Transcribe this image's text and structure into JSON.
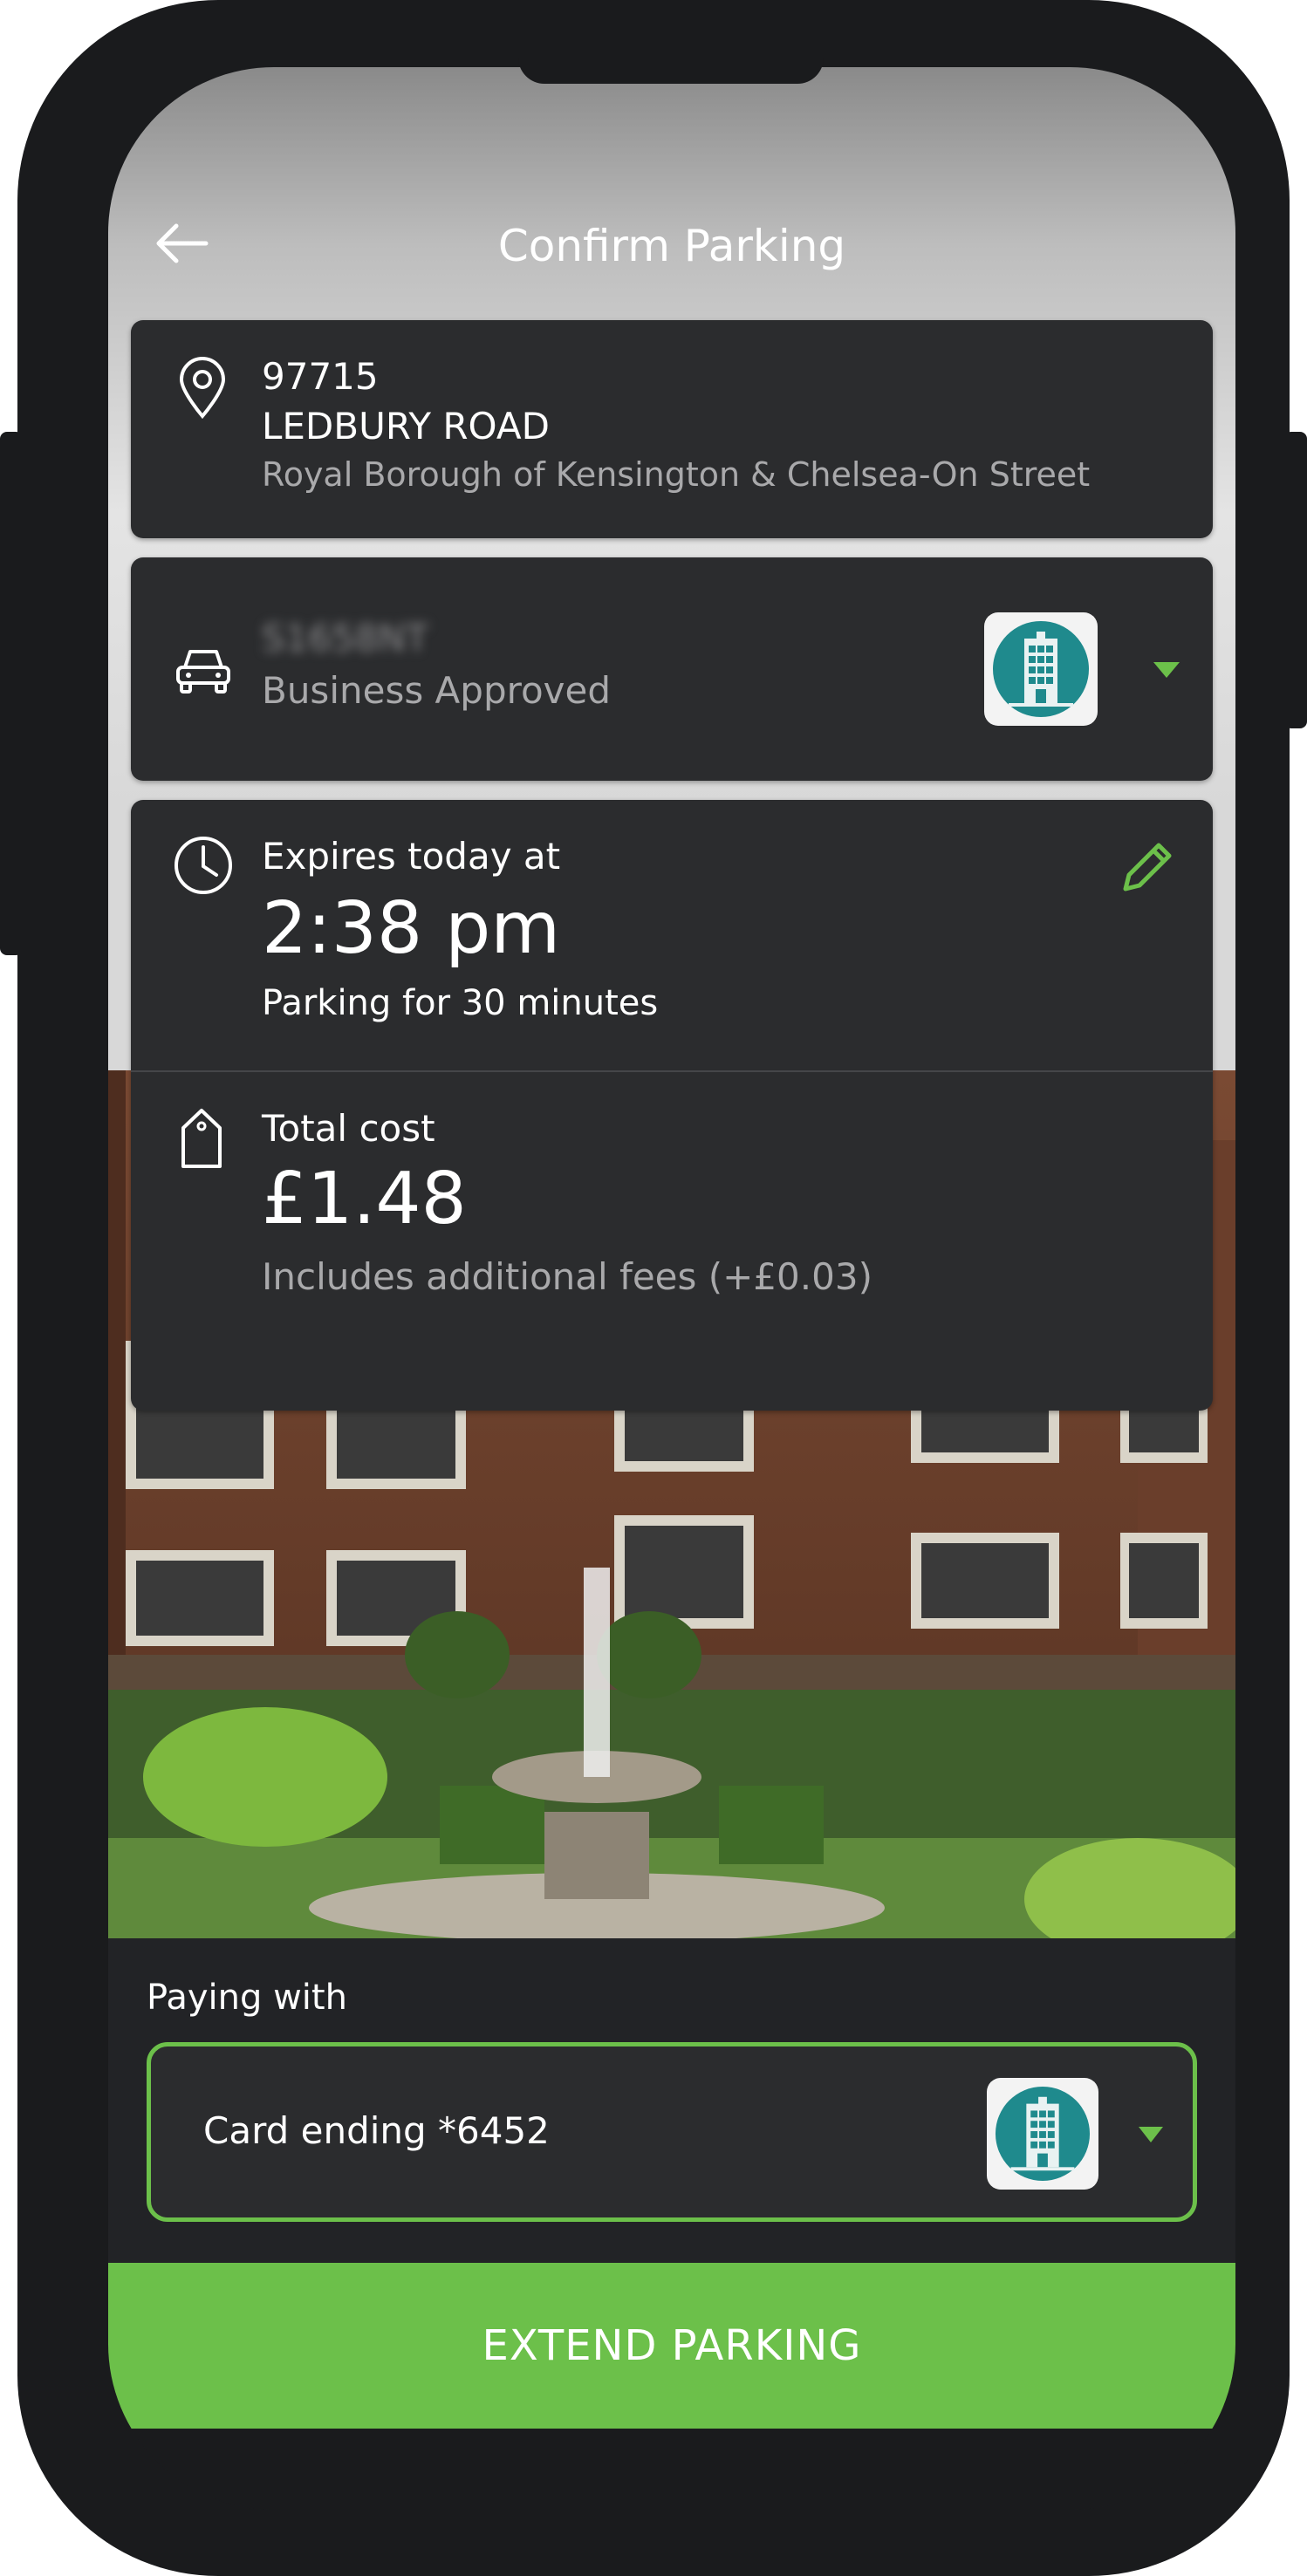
{
  "header": {
    "title": "Confirm Parking"
  },
  "location": {
    "zone": "97715",
    "street": "LEDBURY ROAD",
    "area": "Royal Borough of Kensington & Chelsea-On Street"
  },
  "vehicle": {
    "plate": "S1658NT",
    "status": "Business Approved"
  },
  "expiry": {
    "label": "Expires today at",
    "time": "2:38 pm",
    "duration": "Parking for 30 minutes"
  },
  "cost": {
    "label": "Total cost",
    "amount": "£1.48",
    "fees_note": "Includes additional fees (+£0.03)"
  },
  "payment": {
    "label": "Paying with",
    "card": "Card ending *6452"
  },
  "action": {
    "extend_label": "EXTEND PARKING"
  },
  "colors": {
    "accent": "#6cc04a",
    "card_bg": "#2b2c2e",
    "teal": "#1f8a8d"
  },
  "icons": [
    "back-arrow-icon",
    "location-pin-icon",
    "car-icon",
    "building-icon",
    "dropdown-icon",
    "clock-icon",
    "edit-pencil-icon",
    "price-tag-icon"
  ]
}
